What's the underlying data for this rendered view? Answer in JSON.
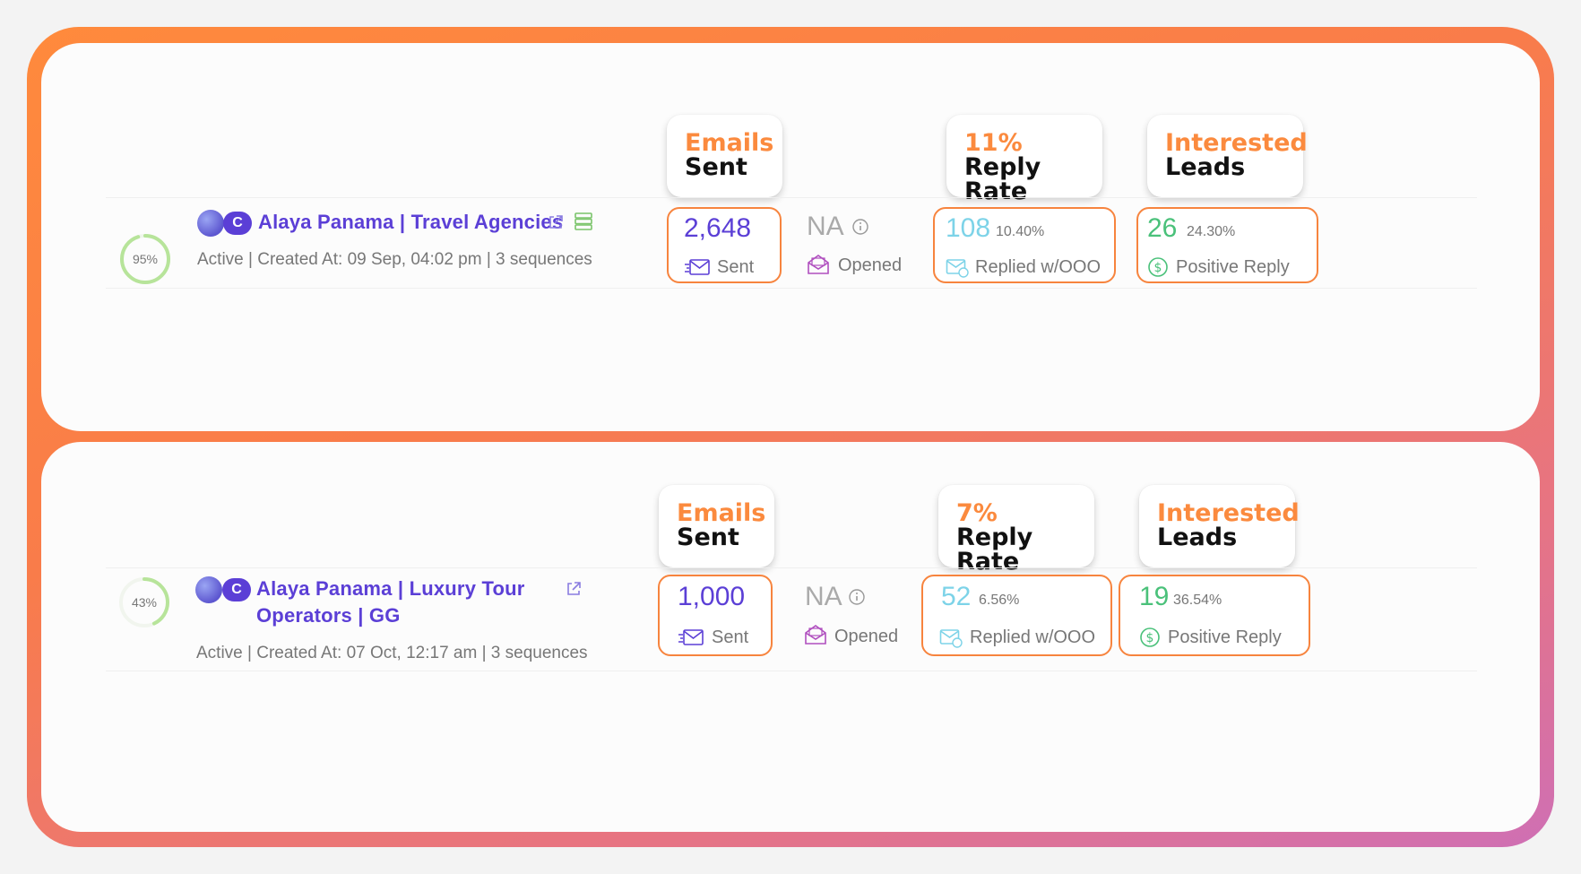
{
  "colors": {
    "accent_orange": "#f7843e",
    "brand_purple": "#5b3fd6",
    "reply_teal": "#7dd3e8",
    "positive_green": "#4ac17a",
    "opened_purple": "#b04fbf"
  },
  "campaigns": [
    {
      "progress_label": "95%",
      "progress": 0.95,
      "badge": "C",
      "name": "Alaya Panama | Travel Agencies",
      "meta": "Active | Created At: 09 Sep, 04:02 pm | 3 sequences",
      "headers": {
        "emails_1": "Emails",
        "emails_2": "Sent",
        "reply_1": "11%",
        "reply_2": "Reply Rate",
        "leads_1": "Interested",
        "leads_2": "Leads"
      },
      "sent": {
        "value": "2,648",
        "label": "Sent"
      },
      "opened": {
        "value": "NA",
        "label": "Opened"
      },
      "replied": {
        "value": "108",
        "pct": "10.40%",
        "label": "Replied w/OOO"
      },
      "positive": {
        "value": "26",
        "pct": "24.30%",
        "label": "Positive Reply"
      }
    },
    {
      "progress_label": "43%",
      "progress": 0.43,
      "badge": "C",
      "name_line1": "Alaya Panama | Luxury Tour",
      "name_line2": "Operators | GG",
      "meta": "Active | Created At: 07 Oct, 12:17 am | 3 sequences",
      "headers": {
        "emails_1": "Emails",
        "emails_2": "Sent",
        "reply_1": "7%",
        "reply_2": "Reply Rate",
        "leads_1": "Interested",
        "leads_2": "Leads"
      },
      "sent": {
        "value": "1,000",
        "label": "Sent"
      },
      "opened": {
        "value": "NA",
        "label": "Opened"
      },
      "replied": {
        "value": "52",
        "pct": "6.56%",
        "label": "Replied w/OOO"
      },
      "positive": {
        "value": "19",
        "pct": "36.54%",
        "label": "Positive Reply"
      }
    }
  ]
}
